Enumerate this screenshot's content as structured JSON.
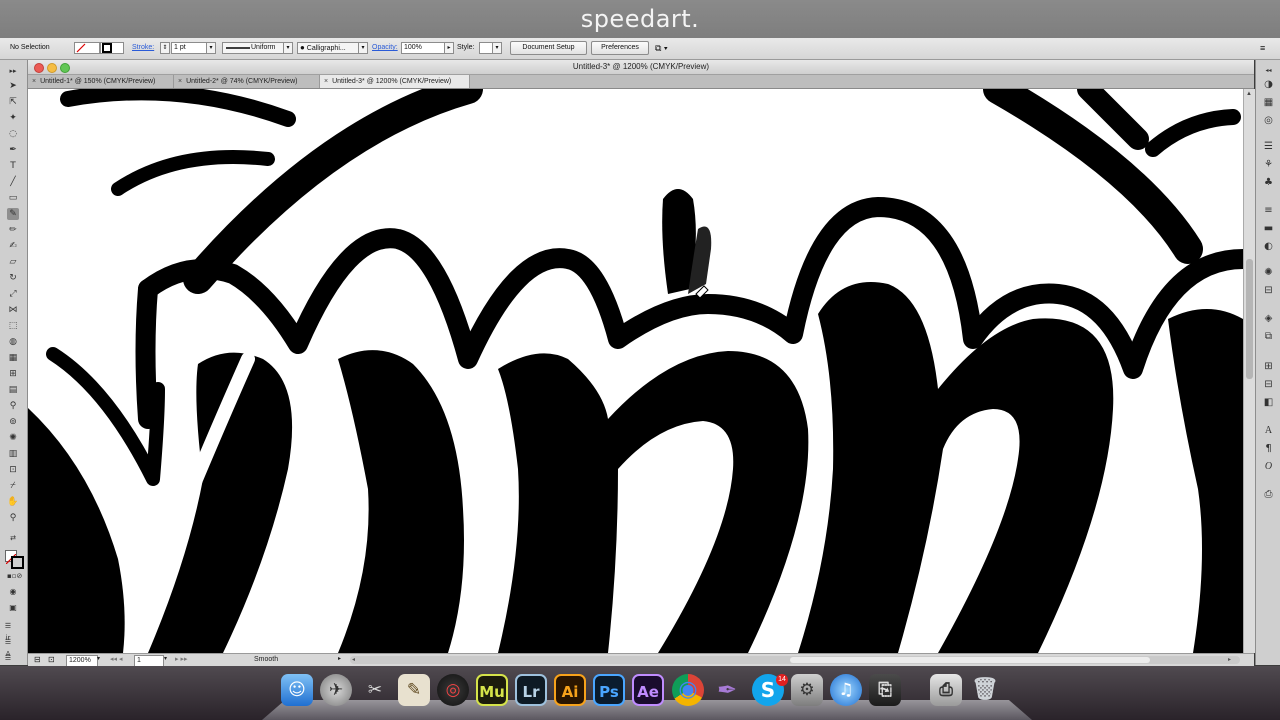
{
  "banner": {
    "title": "speedart."
  },
  "control_bar": {
    "selection": "No Selection",
    "stroke_label": "Stroke:",
    "stroke_value": "1 pt",
    "profile": "Uniform",
    "brush": "Calligraphi...",
    "opacity_label": "Opacity:",
    "opacity_value": "100%",
    "style_label": "Style:",
    "document_setup": "Document Setup",
    "preferences": "Preferences"
  },
  "window": {
    "title": "Untitled-3* @ 1200% (CMYK/Preview)"
  },
  "tabs": [
    {
      "label": "Untitled-1* @ 150% (CMYK/Preview)",
      "close": "×",
      "active": false
    },
    {
      "label": "Untitled-2* @ 74% (CMYK/Preview)",
      "close": "×",
      "active": false
    },
    {
      "label": "Untitled-3* @ 1200% (CMYK/Preview)",
      "close": "×",
      "active": true
    }
  ],
  "status": {
    "zoom": "1200%",
    "page": "1",
    "mode": "Smooth"
  },
  "dock": {
    "apps": [
      {
        "name": "finder-icon",
        "glyph": "☺"
      },
      {
        "name": "launchpad-icon",
        "glyph": "✈"
      },
      {
        "name": "scripteditor-icon",
        "glyph": "✂"
      },
      {
        "name": "pencil-app-icon",
        "glyph": "✎"
      },
      {
        "name": "creative-cloud-icon",
        "glyph": "◎"
      },
      {
        "name": "muse-icon",
        "glyph": "Mu"
      },
      {
        "name": "lightroom-icon",
        "glyph": "Lr"
      },
      {
        "name": "illustrator-icon",
        "glyph": "Ai"
      },
      {
        "name": "photoshop-icon",
        "glyph": "Ps"
      },
      {
        "name": "aftereffects-icon",
        "glyph": "Ae"
      },
      {
        "name": "chrome-icon",
        "glyph": "◉"
      },
      {
        "name": "feather-icon",
        "glyph": "✒"
      },
      {
        "name": "skype-icon",
        "glyph": "S"
      },
      {
        "name": "systemprefs-icon",
        "glyph": "⚙"
      },
      {
        "name": "itunes-icon",
        "glyph": "♫"
      },
      {
        "name": "photobooth-icon",
        "glyph": "⎘"
      },
      {
        "name": "printer-icon",
        "glyph": "⎙"
      },
      {
        "name": "trash-icon",
        "glyph": "🗑"
      }
    ],
    "skype_badge": "14"
  },
  "colors": {
    "illustrator_orange": "#f7a21b",
    "photoshop_blue": "#4aa6ff",
    "ae_purple": "#c08cff"
  }
}
